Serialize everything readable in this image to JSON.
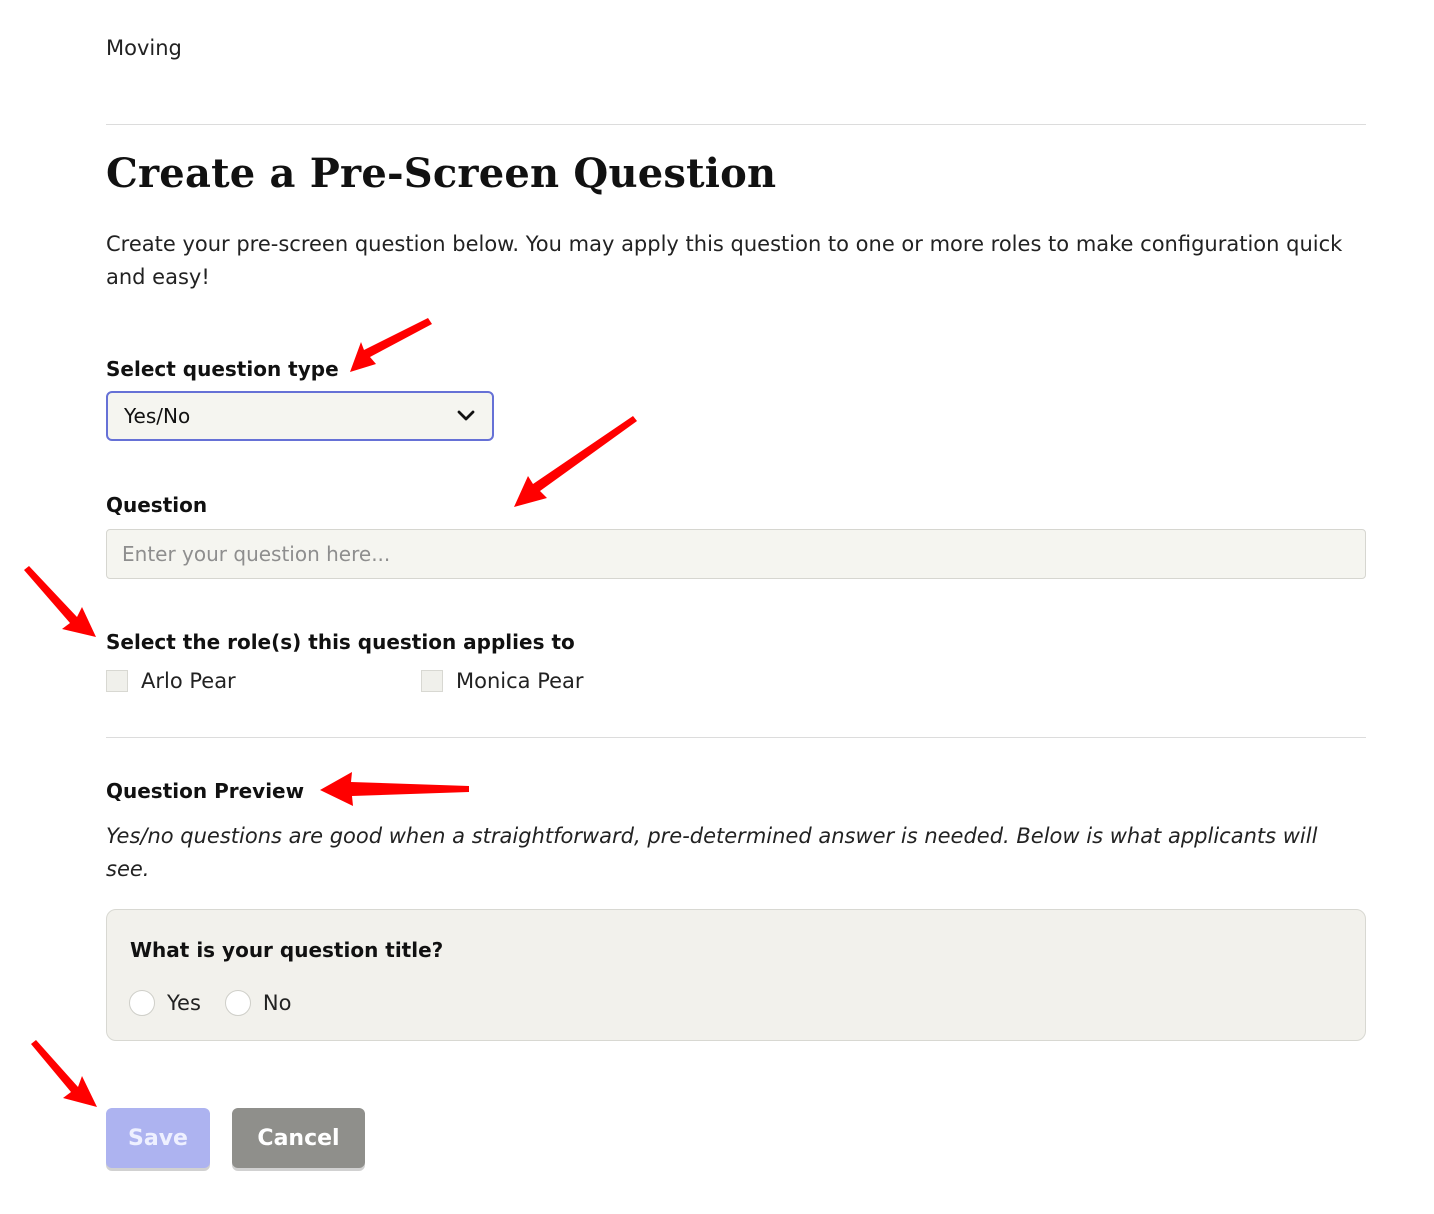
{
  "breadcrumb": "Moving",
  "page_title": "Create a Pre-Screen Question",
  "intro_text": "Create your pre-screen question below. You may apply this question to one or more roles to make configuration quick and easy!",
  "question_type": {
    "label": "Select question type",
    "selected": "Yes/No",
    "icon": "chevron-down-icon"
  },
  "question": {
    "label": "Question",
    "value": "",
    "placeholder": "Enter your question here..."
  },
  "roles": {
    "label": "Select the role(s) this question applies to",
    "items": [
      {
        "label": "Arlo Pear",
        "checked": false
      },
      {
        "label": "Monica Pear",
        "checked": false
      }
    ]
  },
  "preview": {
    "label": "Question Preview",
    "description": "Yes/no questions are good when a straightforward, pre-determined answer is needed. Below is what applicants will see.",
    "question_title": "What is your question title?",
    "options": [
      "Yes",
      "No"
    ]
  },
  "actions": {
    "save_label": "Save",
    "cancel_label": "Cancel"
  },
  "colors": {
    "accent": "#6671d6",
    "save_button": "#adb3f0",
    "cancel_button": "#8f8f8b",
    "annotation_arrow": "#ff0000"
  }
}
